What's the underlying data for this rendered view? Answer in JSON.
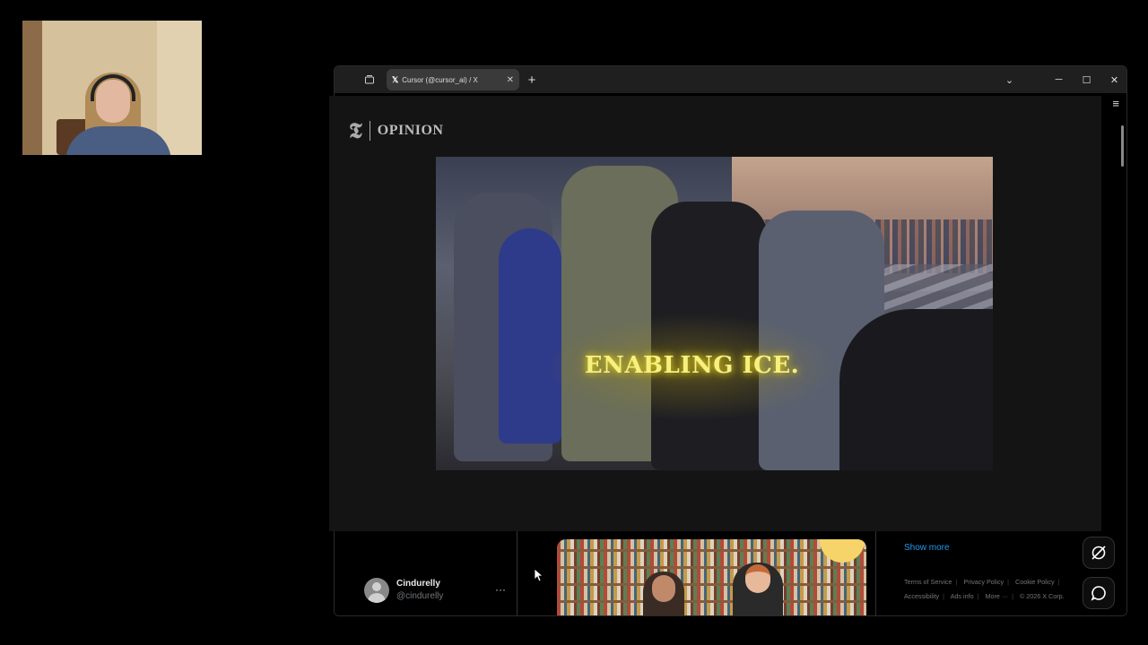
{
  "browser": {
    "tab": {
      "title": "Cursor (@cursor_ai) / X",
      "favicon": "x-logo"
    },
    "window_buttons": [
      "minimize",
      "maximize",
      "close"
    ]
  },
  "overlay": {
    "brand": {
      "logo": "nyt-t",
      "section": "OPINION"
    },
    "video_caption": "ENABLING ICE."
  },
  "feed": {
    "user_card": {
      "name": "Cindurelly",
      "handle": "@cindurelly",
      "more": "···"
    }
  },
  "sidebar": {
    "show_more": "Show more",
    "footer_links": [
      "Terms of Service",
      "Privacy Policy",
      "Cookie Policy",
      "Accessibility",
      "Ads info",
      "More ···",
      "© 2026 X Corp."
    ]
  },
  "colors": {
    "accent": "#1d9bf0",
    "caption": "#f6f080",
    "background": "#000000"
  }
}
